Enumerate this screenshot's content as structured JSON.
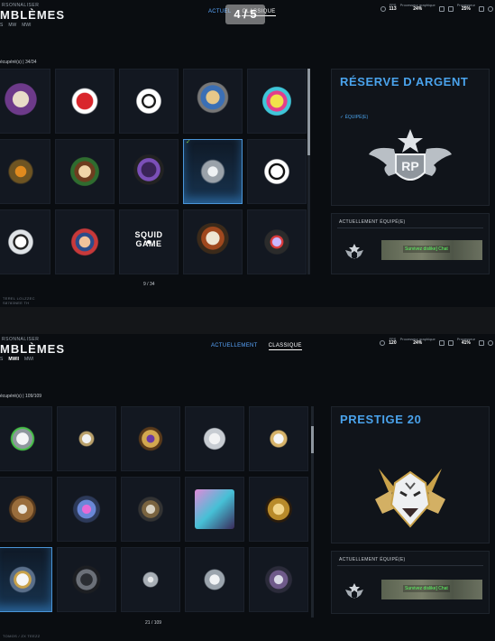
{
  "top": {
    "header": {
      "small": "RSONNALISER",
      "title": "MBLÈMES",
      "subtabs": [
        "S",
        "MW",
        "MWI"
      ]
    },
    "center_tabs": [
      "ACTUEL",
      "CLASSIQUE"
    ],
    "page_indicator": "4 / 5",
    "status": {
      "fps": "113",
      "proc_gpu_label": "Processeur graphique",
      "proc_gpu": "24%",
      "proc_label": "Processeur",
      "proc": "25%"
    },
    "counter": "écupéré(s) | 34/34",
    "grid_icons": [
      "skull-snake-emblem-icon",
      "red-a-splatter-emblem-icon",
      "white-tribal-emblem-icon",
      "rider-motorbike-emblem-icon",
      "colorful-skull-emblem-icon",
      "armored-truck-emblem-icon",
      "monkey-character-emblem-icon",
      "purple-soldier-emblem-icon",
      "rp-winged-emblem-icon",
      "skull-guns-emblem-icon",
      "white-wolf-emblem-icon",
      "operator-portrait-emblem-icon",
      "squid-game-emblem-icon",
      "skull-warrior-emblem-icon",
      "diamond-laser-emblem-icon"
    ],
    "squid_text": [
      "SQUID",
      "GAME"
    ],
    "page_num": "9 / 34",
    "detail": {
      "title": "RÉSERVE D'ARGENT",
      "equipped": "✓ ÉQUIPÉ(E)",
      "emblem_text": "RP"
    },
    "equipped": {
      "label": "ACTUELLEMENT ÉQUIPÉ(E)",
      "card_text": "Survivez dislike] Chat"
    },
    "footer": [
      "TEREL LOLZZEC",
      "S8783NEE TH"
    ]
  },
  "bottom": {
    "header": {
      "small": "RSONNALISER",
      "title": "MBLÈMES",
      "subtabs": [
        "S",
        "MWII",
        "MWI"
      ]
    },
    "center_tabs": [
      "ACTUELLEMENT",
      "CLASSIQUE"
    ],
    "status": {
      "fps": "120",
      "proc_gpu_label": "Processeur graphique",
      "proc_gpu": "24%",
      "proc_label": "Processeur",
      "proc": "41%"
    },
    "counter": "écupéré(s) | 109/109",
    "grid_icons": [
      "wolf-prestige-green-icon",
      "wolf-prestige-small-icon",
      "gold-gem-prestige-icon",
      "wolf-prestige-winged-icon",
      "wolf-prestige-gold-icon",
      "bronze-bull-emblem-icon",
      "pink-gun-orb-icon",
      "skull-swords-emblem-icon",
      "anime-girl-card-icon",
      "golden-skull-emblem-icon",
      "white-tiger-prestige-icon",
      "gasmask-soldier-icon",
      "winged-medal-icon",
      "wolf-prestige-silver-icon",
      "ghost-orb-emblem-icon"
    ],
    "page_num": "21 / 109",
    "detail": {
      "title": "PRESTIGE 20"
    },
    "equipped": {
      "label": "ACTUELLEMENT ÉQUIPÉ(E)",
      "card_text": "Survivez dislike] Chat"
    },
    "footer": [
      "TOMOS / ZX TEEZZ"
    ]
  },
  "colors": {
    "accent_blue": "#4aa3ec",
    "green_text": "#5dff63",
    "check_green": "#7ec44c"
  }
}
